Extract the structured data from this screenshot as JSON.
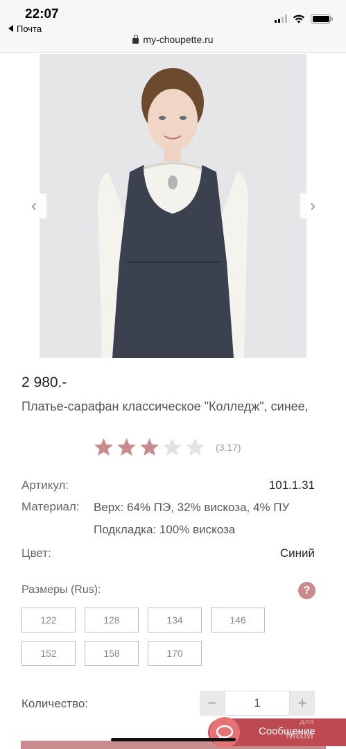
{
  "status_bar": {
    "time": "22:07",
    "back_label": "Почта",
    "url": "my-choupette.ru"
  },
  "gallery": {
    "prev_label": "‹",
    "next_label": "›"
  },
  "product": {
    "price": "2 980.-",
    "title": "Платье-сарафан классическое \"Колледж\", синее,",
    "rating": 3.17,
    "rating_text": "(3.17)",
    "stars_filled": 3,
    "stars_total": 5
  },
  "specs": {
    "article_label": "Артикул:",
    "article_value": "101.1.31",
    "material_label": "Материал:",
    "material_line1": "Верх: 64% ПЭ, 32% вискоза, 4% ПУ",
    "material_line2": "Подкладка: 100% вискоза",
    "color_label": "Цвет:",
    "color_value": "Синий"
  },
  "sizes": {
    "label": "Размеры (Rus):",
    "help": "?",
    "options": [
      "122",
      "128",
      "134",
      "146",
      "152",
      "158",
      "170"
    ]
  },
  "quantity": {
    "label": "Количество:",
    "minus": "−",
    "value": "1",
    "plus": "+"
  },
  "chat": {
    "label": "Сообщение"
  },
  "watermark": {
    "line1": "для",
    "line2": "мам"
  },
  "colors": {
    "accent": "#c98b8e",
    "star_filled": "#c98b8e",
    "star_empty": "#e3e3e3",
    "chat_bg": "#bd4a52"
  }
}
